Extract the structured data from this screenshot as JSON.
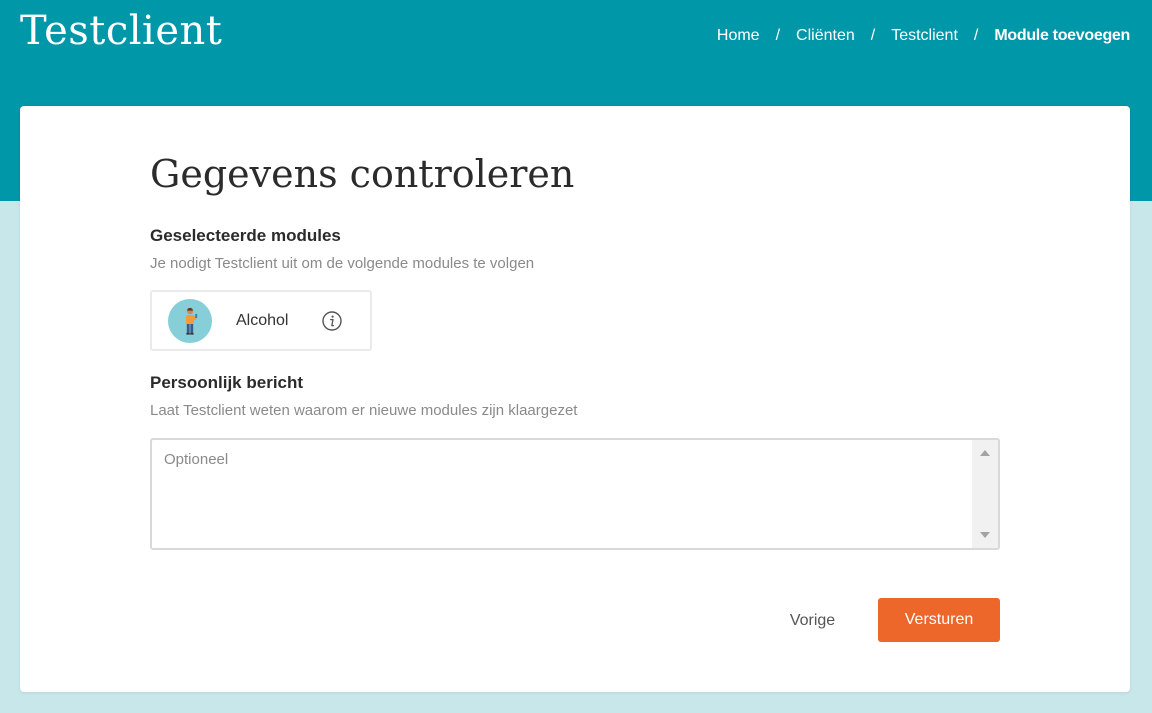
{
  "header": {
    "title": "Testclient",
    "breadcrumb": [
      {
        "label": "Home"
      },
      {
        "label": "Cliënten"
      },
      {
        "label": "Testclient"
      },
      {
        "label": "Module toevoegen"
      }
    ],
    "separator": "/"
  },
  "main": {
    "title": "Gegevens controleren",
    "selected_modules": {
      "heading": "Geselecteerde modules",
      "description": "Je nodigt Testclient uit om de volgende modules te volgen",
      "modules": [
        {
          "name": "Alcohol",
          "icon": "person-illustration-icon",
          "info_icon": "info-icon"
        }
      ]
    },
    "personal_message": {
      "heading": "Persoonlijk bericht",
      "description": "Laat Testclient weten waarom er nieuwe modules zijn klaargezet",
      "placeholder": "Optioneel",
      "value": ""
    },
    "actions": {
      "previous_label": "Vorige",
      "submit_label": "Versturen"
    }
  },
  "colors": {
    "header_bg": "#0097a9",
    "page_bg": "#c8e7eb",
    "accent": "#ec6729",
    "module_avatar_bg": "#86cfd8"
  }
}
